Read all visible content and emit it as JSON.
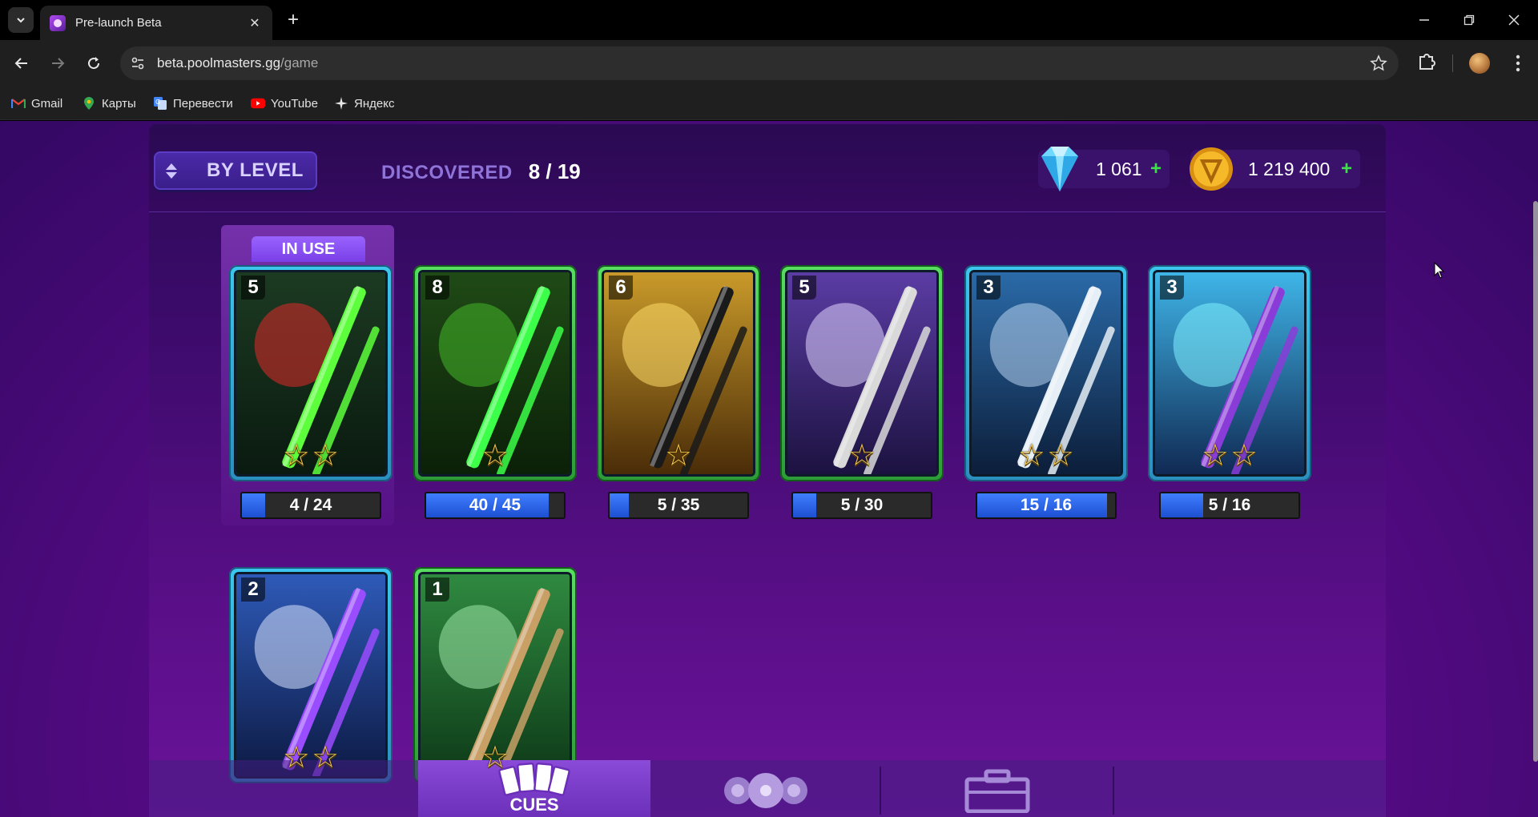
{
  "browser": {
    "tab_title": "Pre-launch Beta",
    "url_host": "beta.poolmasters.gg",
    "url_path": "/game",
    "bookmarks": [
      {
        "label": "Gmail",
        "icon": "gmail-icon"
      },
      {
        "label": "Карты",
        "icon": "maps-icon"
      },
      {
        "label": "Перевести",
        "icon": "translate-icon"
      },
      {
        "label": "YouTube",
        "icon": "youtube-icon"
      },
      {
        "label": "Яндекс",
        "icon": "yandex-icon"
      }
    ]
  },
  "game": {
    "sort_label": "BY LEVEL",
    "discovered_label": "DISCOVERED",
    "discovered_value": "8 / 19",
    "gems": "1 061",
    "coins": "1 219 400",
    "plus": "+",
    "in_use_label": "IN USE",
    "cards": [
      {
        "level": "5",
        "stars": 2,
        "progress": "4 / 24",
        "fill": 0.167,
        "frame": "blue",
        "theme": "frog",
        "in_use": true
      },
      {
        "level": "8",
        "stars": 1,
        "progress": "40 / 45",
        "fill": 0.889,
        "frame": "green",
        "theme": "snake"
      },
      {
        "level": "6",
        "stars": 1,
        "progress": "5 / 35",
        "fill": 0.143,
        "frame": "green",
        "theme": "ninja"
      },
      {
        "level": "5",
        "stars": 1,
        "progress": "5 / 30",
        "fill": 0.167,
        "frame": "green",
        "theme": "magician"
      },
      {
        "level": "3",
        "stars": 2,
        "progress": "15 / 16",
        "fill": 0.9375,
        "frame": "blue",
        "theme": "knight"
      },
      {
        "level": "3",
        "stars": 2,
        "progress": "5 / 16",
        "fill": 0.3125,
        "frame": "blue",
        "theme": "voodoo"
      },
      {
        "level": "2",
        "stars": 2,
        "progress": "",
        "fill": 0,
        "frame": "blue",
        "theme": "wizard"
      },
      {
        "level": "1",
        "stars": 1,
        "progress": "",
        "fill": 0,
        "frame": "green",
        "theme": "classic"
      }
    ],
    "nav": {
      "cues_label": "CUES"
    }
  }
}
